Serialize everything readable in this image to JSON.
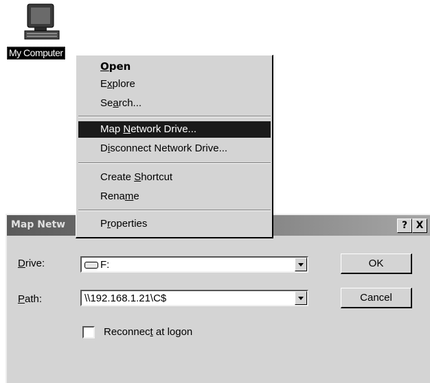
{
  "desktop": {
    "icon_label": "My Computer",
    "icon_name": "my-computer-icon"
  },
  "context_menu": {
    "items": [
      {
        "label_pre": "",
        "label_key": "O",
        "label_post": "pen"
      },
      {
        "label_pre": "E",
        "label_key": "x",
        "label_post": "plore"
      },
      {
        "label_pre": "Se",
        "label_key": "a",
        "label_post": "rch..."
      },
      {
        "label_pre": "Map ",
        "label_key": "N",
        "label_post": "etwork Drive..."
      },
      {
        "label_pre": "D",
        "label_key": "i",
        "label_post": "sconnect Network Drive..."
      },
      {
        "label_pre": "Create ",
        "label_key": "S",
        "label_post": "hortcut"
      },
      {
        "label_pre": "Rena",
        "label_key": "m",
        "label_post": "e"
      },
      {
        "label_pre": "P",
        "label_key": "r",
        "label_post": "operties"
      }
    ],
    "highlight_color": "#1a1a1a"
  },
  "dialog": {
    "title": "Map Netw",
    "help_label": "?",
    "close_label": "X",
    "drive_label_key": "D",
    "drive_label_rest": "rive:",
    "drive_value": "F:",
    "path_label_key": "P",
    "path_label_rest": "ath:",
    "path_value": "\\\\192.168.1.21\\C$",
    "ok_label": "OK",
    "cancel_label": "Cancel",
    "reconnect_pre": "Reconnec",
    "reconnect_key": "t",
    "reconnect_post": " at logon"
  }
}
